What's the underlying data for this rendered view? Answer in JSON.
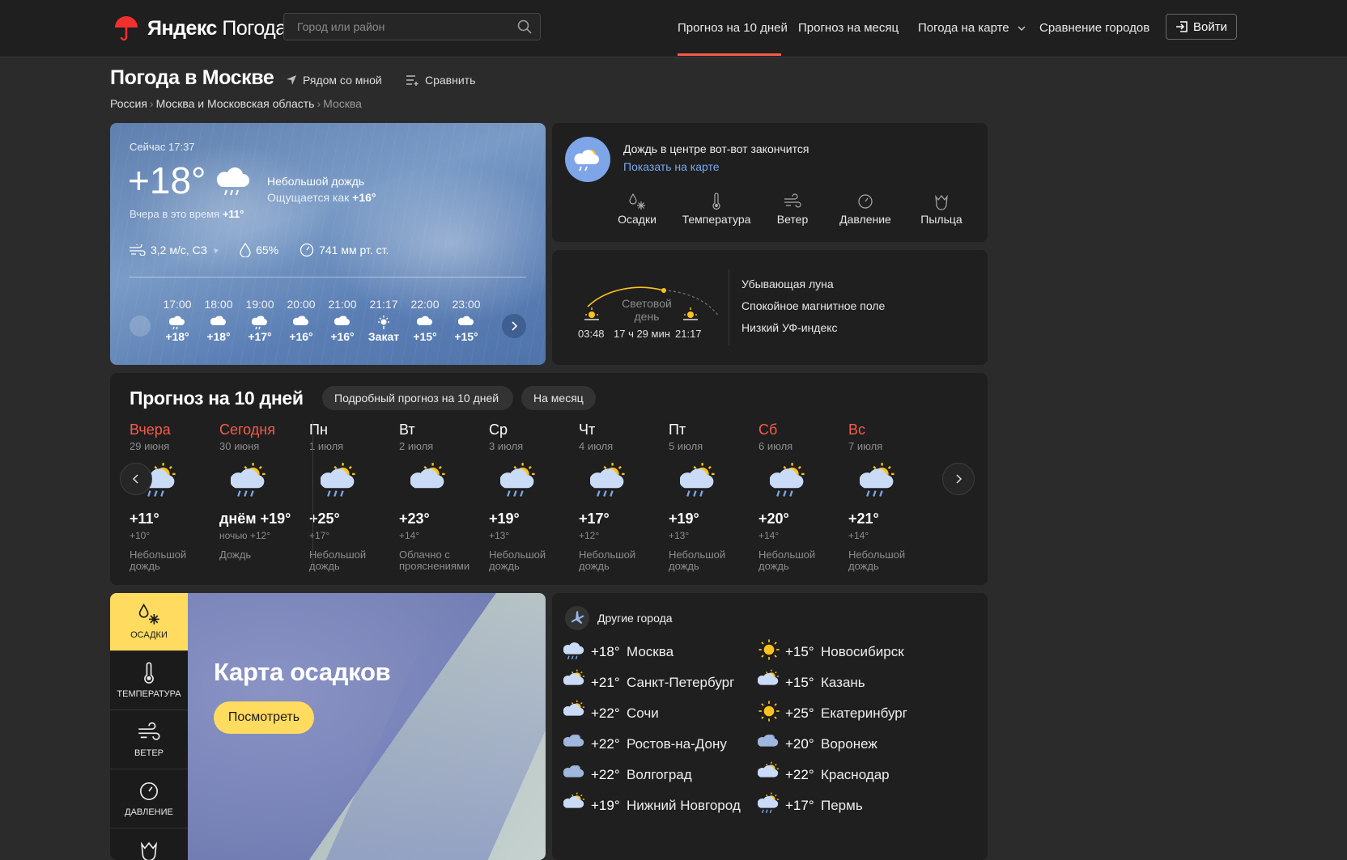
{
  "header": {
    "brand_ru": "Яндекс",
    "brand_product": "Погода",
    "search_placeholder": "Город или район",
    "nav": [
      "Прогноз на 10 дней",
      "Прогноз на месяц",
      "Погода на карте",
      "Сравнение городов"
    ],
    "login": "Войти",
    "accent_color": "#f55b4a"
  },
  "page": {
    "title": "Погода в Москве",
    "near_me": "Рядом со мной",
    "compare": "Сравнить",
    "breadcrumbs": [
      "Россия",
      "Москва и Московская область",
      "Москва"
    ]
  },
  "current": {
    "now_label": "Сейчас 17:37",
    "temp": "+18°",
    "condition": "Небольшой дождь",
    "feels_label": "Ощущается как",
    "feels_value": "+16°",
    "yesterday_label": "Вчера в это время",
    "yesterday_value": "+11°",
    "wind": "3,2 м/с, СЗ",
    "humidity": "65%",
    "pressure": "741 мм рт. ст.",
    "hours": [
      {
        "time": "17:00",
        "temp": "+18°",
        "icon": "rain-icon"
      },
      {
        "time": "18:00",
        "temp": "+18°",
        "icon": "partly-cloudy-icon"
      },
      {
        "time": "19:00",
        "temp": "+17°",
        "icon": "sun-rain-icon"
      },
      {
        "time": "20:00",
        "temp": "+16°",
        "icon": "sun-cloud-icon"
      },
      {
        "time": "21:00",
        "temp": "+16°",
        "icon": "sun-cloud-icon"
      },
      {
        "time": "21:17",
        "temp": "Закат",
        "icon": "sunset-icon"
      },
      {
        "time": "22:00",
        "temp": "+15°",
        "icon": "cloud-icon"
      },
      {
        "time": "23:00",
        "temp": "+15°",
        "icon": "cloud-icon"
      }
    ]
  },
  "alert": {
    "text": "Дождь в центре вот-вот закончится",
    "link": "Показать на карте",
    "layers": [
      "Осадки",
      "Температура",
      "Ветер",
      "Давление",
      "Пыльца"
    ]
  },
  "sun": {
    "label_line1": "Световой",
    "label_line2": "день",
    "sunrise": "03:48",
    "duration": "17 ч 29 мин",
    "sunset": "21:17",
    "info": [
      "Убывающая луна",
      "Спокойное магнитное поле",
      "Низкий УФ-индекс"
    ]
  },
  "forecast": {
    "title": "Прогноз на 10 дней",
    "detail_button": "Подробный прогноз на 10 дней",
    "month_button": "На месяц",
    "days": [
      {
        "name": "Вчера",
        "date": "29 июня",
        "hi": "+11°",
        "lo": "+10°",
        "desc": "Небольшой дождь",
        "red": true,
        "icon": "sun-rain-icon"
      },
      {
        "name": "Сегодня",
        "date": "30 июня",
        "hi": "днём +19°",
        "lo": "ночью +12°",
        "desc": "Дождь",
        "red": true,
        "icon": "sun-rain-icon"
      },
      {
        "name": "Пн",
        "date": "1 июля",
        "hi": "+25°",
        "lo": "+17°",
        "desc": "Небольшой дождь",
        "red": false,
        "icon": "sun-rain-icon"
      },
      {
        "name": "Вт",
        "date": "2 июля",
        "hi": "+23°",
        "lo": "+14°",
        "desc": "Облачно с прояснениями",
        "red": false,
        "icon": "sun-cloud-icon"
      },
      {
        "name": "Ср",
        "date": "3 июля",
        "hi": "+19°",
        "lo": "+13°",
        "desc": "Небольшой дождь",
        "red": false,
        "icon": "sun-rain-icon"
      },
      {
        "name": "Чт",
        "date": "4 июля",
        "hi": "+17°",
        "lo": "+12°",
        "desc": "Небольшой дождь",
        "red": false,
        "icon": "sun-rain-icon"
      },
      {
        "name": "Пт",
        "date": "5 июля",
        "hi": "+19°",
        "lo": "+13°",
        "desc": "Небольшой дождь",
        "red": false,
        "icon": "sun-rain-icon"
      },
      {
        "name": "Сб",
        "date": "6 июля",
        "hi": "+20°",
        "lo": "+14°",
        "desc": "Небольшой дождь",
        "red": true,
        "icon": "sun-rain-icon"
      },
      {
        "name": "Вс",
        "date": "7 июля",
        "hi": "+21°",
        "lo": "+14°",
        "desc": "Небольшой дождь",
        "red": true,
        "icon": "sun-rain-icon"
      }
    ]
  },
  "map": {
    "title": "Карта осадков",
    "button": "Посмотреть",
    "tabs": [
      "ОСАДКИ",
      "ТЕМПЕРАТУРА",
      "ВЕТЕР",
      "ДАВЛЕНИЕ"
    ]
  },
  "cities": {
    "title": "Другие города",
    "list": [
      {
        "temp": "+18°",
        "name": "Москва",
        "icon": "rain-cloud-icon"
      },
      {
        "temp": "+15°",
        "name": "Новосибирск",
        "icon": "sun-icon"
      },
      {
        "temp": "+21°",
        "name": "Санкт-Петербург",
        "icon": "sun-cloud-icon"
      },
      {
        "temp": "+15°",
        "name": "Казань",
        "icon": "sun-cloud-icon"
      },
      {
        "temp": "+22°",
        "name": "Сочи",
        "icon": "sun-cloud-icon"
      },
      {
        "temp": "+25°",
        "name": "Екатеринбург",
        "icon": "sun-icon"
      },
      {
        "temp": "+22°",
        "name": "Ростов-на-Дону",
        "icon": "cloud-icon"
      },
      {
        "temp": "+20°",
        "name": "Воронеж",
        "icon": "cloud-icon"
      },
      {
        "temp": "+22°",
        "name": "Волгоград",
        "icon": "cloud-icon"
      },
      {
        "temp": "+22°",
        "name": "Краснодар",
        "icon": "sun-cloud-icon"
      },
      {
        "temp": "+19°",
        "name": "Нижний Новгород",
        "icon": "sun-cloud-icon"
      },
      {
        "temp": "+17°",
        "name": "Пермь",
        "icon": "sun-rain-icon"
      }
    ]
  }
}
